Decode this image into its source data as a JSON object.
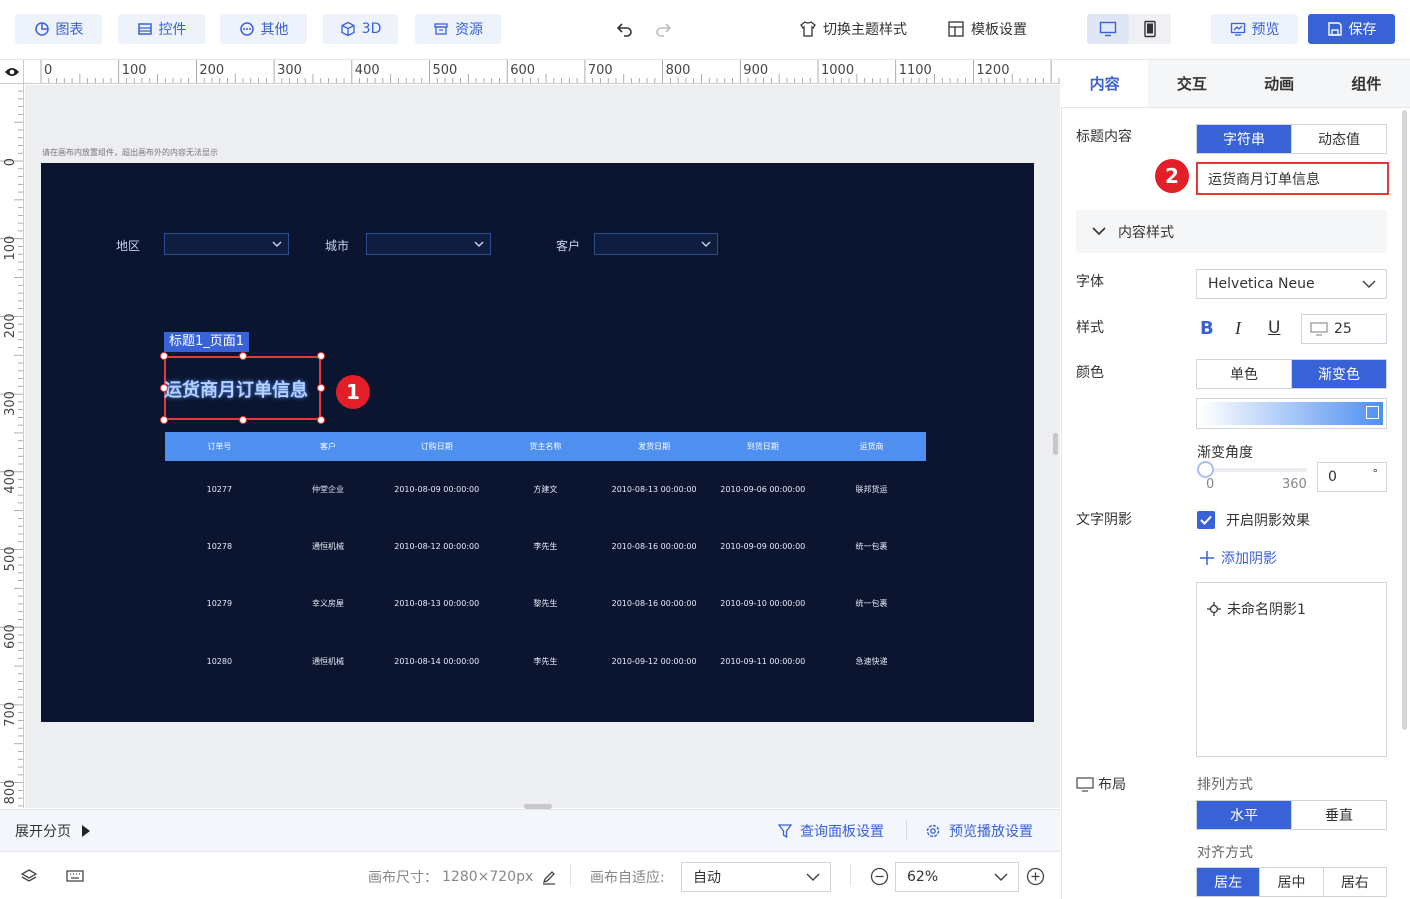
{
  "toolbar": {
    "chart_label": "图表",
    "control_label": "控件",
    "other_label": "其他",
    "three_d_label": "3D",
    "resource_label": "资源",
    "theme_label": "切换主题样式",
    "template_label": "模板设置",
    "preview_label": "预览",
    "save_label": "保存"
  },
  "ruler": {
    "top": [
      "0",
      "100",
      "200",
      "300",
      "400",
      "500",
      "600",
      "700",
      "800",
      "900",
      "1000",
      "1100",
      "1200"
    ],
    "left": [
      "0",
      "100",
      "200",
      "300",
      "400",
      "500",
      "600",
      "700",
      "800"
    ]
  },
  "canvas": {
    "hint": "请在画布内放置组件，超出画布外的内容无法显示",
    "filters": [
      {
        "label": "地区"
      },
      {
        "label": "城市"
      },
      {
        "label": "客户"
      }
    ],
    "component_tag": "标题1_页面1",
    "title_text": "运货商月订单信息",
    "table": {
      "headers": [
        "订单号",
        "客户",
        "订购日期",
        "货主名称",
        "发货日期",
        "到货日期",
        "运货商"
      ],
      "rows": [
        [
          "10277",
          "仲堂企业",
          "2010-08-09 00:00:00",
          "方建文",
          "2010-08-13 00:00:00",
          "2010-09-06 00:00:00",
          "联邦货运"
        ],
        [
          "10278",
          "通恒机械",
          "2010-08-12 00:00:00",
          "李先生",
          "2010-08-16 00:00:00",
          "2010-09-09 00:00:00",
          "统一包裹"
        ],
        [
          "10279",
          "幸义房屋",
          "2010-08-13 00:00:00",
          "黎先生",
          "2010-08-16 00:00:00",
          "2010-09-10 00:00:00",
          "统一包裹"
        ],
        [
          "10280",
          "通恒机械",
          "2010-08-14 00:00:00",
          "李先生",
          "2010-09-12 00:00:00",
          "2010-09-11 00:00:00",
          "急速快递"
        ]
      ]
    },
    "badge1": "1",
    "badge2": "2"
  },
  "pagebar": {
    "expand_label": "展开分页",
    "query_panel_label": "查询面板设置",
    "preview_play_label": "预览播放设置"
  },
  "statusbar": {
    "canvas_size_label": "画布尺寸：",
    "canvas_size_value": "1280×720px",
    "auto_fit_label": "画布自适应:",
    "auto_fit_value": "自动",
    "zoom_value": "62%"
  },
  "panel": {
    "tabs": [
      "内容",
      "交互",
      "动画",
      "组件"
    ],
    "title_content_label": "标题内容",
    "type_options": [
      "字符串",
      "动态值"
    ],
    "title_input_value": "运货商月订单信息",
    "content_style_label": "内容样式",
    "font_label": "字体",
    "font_value": "Helvetica Neue",
    "style_label": "样式",
    "bold_glyph": "B",
    "italic_glyph": "I",
    "underline_glyph": "U",
    "font_size": "25",
    "color_label": "颜色",
    "color_options": [
      "单色",
      "渐变色"
    ],
    "gradient_angle_label": "渐变角度",
    "angle_min": "0",
    "angle_max": "360",
    "angle_value": "0",
    "angle_unit": "°",
    "text_shadow_label": "文字阴影",
    "enable_shadow_label": "开启阴影效果",
    "add_shadow_label": "添加阴影",
    "shadow_item_label": "未命名阴影1",
    "layout_label": "布局",
    "arrange_label": "排列方式",
    "arrange_options": [
      "水平",
      "垂直"
    ],
    "align_label": "对齐方式",
    "align_options": [
      "居左",
      "居中",
      "居右"
    ]
  },
  "colors": {
    "accent": "#3a62d7",
    "screen_bg": "#0b1530",
    "table_header": "#4f8ff0",
    "marker_red": "#e21f26"
  }
}
